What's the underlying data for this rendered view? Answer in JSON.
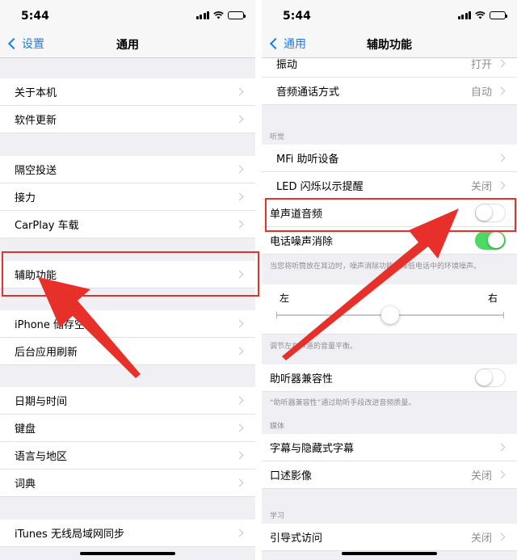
{
  "left_screen": {
    "status_time": "5:44",
    "back_label": "设置",
    "title": "通用",
    "rows": [
      {
        "label": "关于本机"
      },
      {
        "label": "软件更新"
      },
      {
        "label": "隔空投送"
      },
      {
        "label": "接力"
      },
      {
        "label": "CarPlay 车载"
      },
      {
        "label": "辅助功能"
      },
      {
        "label": "iPhone 储存空间"
      },
      {
        "label": "后台应用刷新"
      },
      {
        "label": "日期与时间"
      },
      {
        "label": "键盘"
      },
      {
        "label": "语言与地区"
      },
      {
        "label": "词典"
      },
      {
        "label": "iTunes 无线局域网同步"
      }
    ]
  },
  "right_screen": {
    "status_time": "5:44",
    "back_label": "通用",
    "title": "辅助功能",
    "rows_top": [
      {
        "label": "振动",
        "value": "打开"
      },
      {
        "label": "音频通话方式",
        "value": "自动"
      }
    ],
    "hearing_header": "听觉",
    "hearing_rows": [
      {
        "label": "MFi 助听设备",
        "value": ""
      },
      {
        "label": "LED 闪烁以示提醒",
        "value": "关闭"
      }
    ],
    "mono_audio": {
      "label": "单声道音频",
      "on": false
    },
    "noise_cancel": {
      "label": "电话噪声消除",
      "on": true
    },
    "noise_footnote": "当您将听筒放在耳边时，噪声消除功能会降低电话中的环境噪声。",
    "balance": {
      "left": "左",
      "right": "右",
      "level": 0.5
    },
    "balance_footnote": "调节左右声道的音量平衡。",
    "hac": {
      "label": "助听器兼容性",
      "on": false
    },
    "hac_footnote": "“助听器兼容性”通过助听手段改进音频质量。",
    "media_header": "媒体",
    "media_rows": [
      {
        "label": "字幕与隐藏式字幕",
        "value": ""
      },
      {
        "label": "口述影像",
        "value": "关闭"
      }
    ],
    "learning_header": "学习",
    "learning_rows": [
      {
        "label": "引导式访问",
        "value": "关闭"
      }
    ]
  },
  "colors": {
    "accent": "#1a7cf2",
    "toggle_on": "#4cd964",
    "highlight": "#e8302a"
  }
}
